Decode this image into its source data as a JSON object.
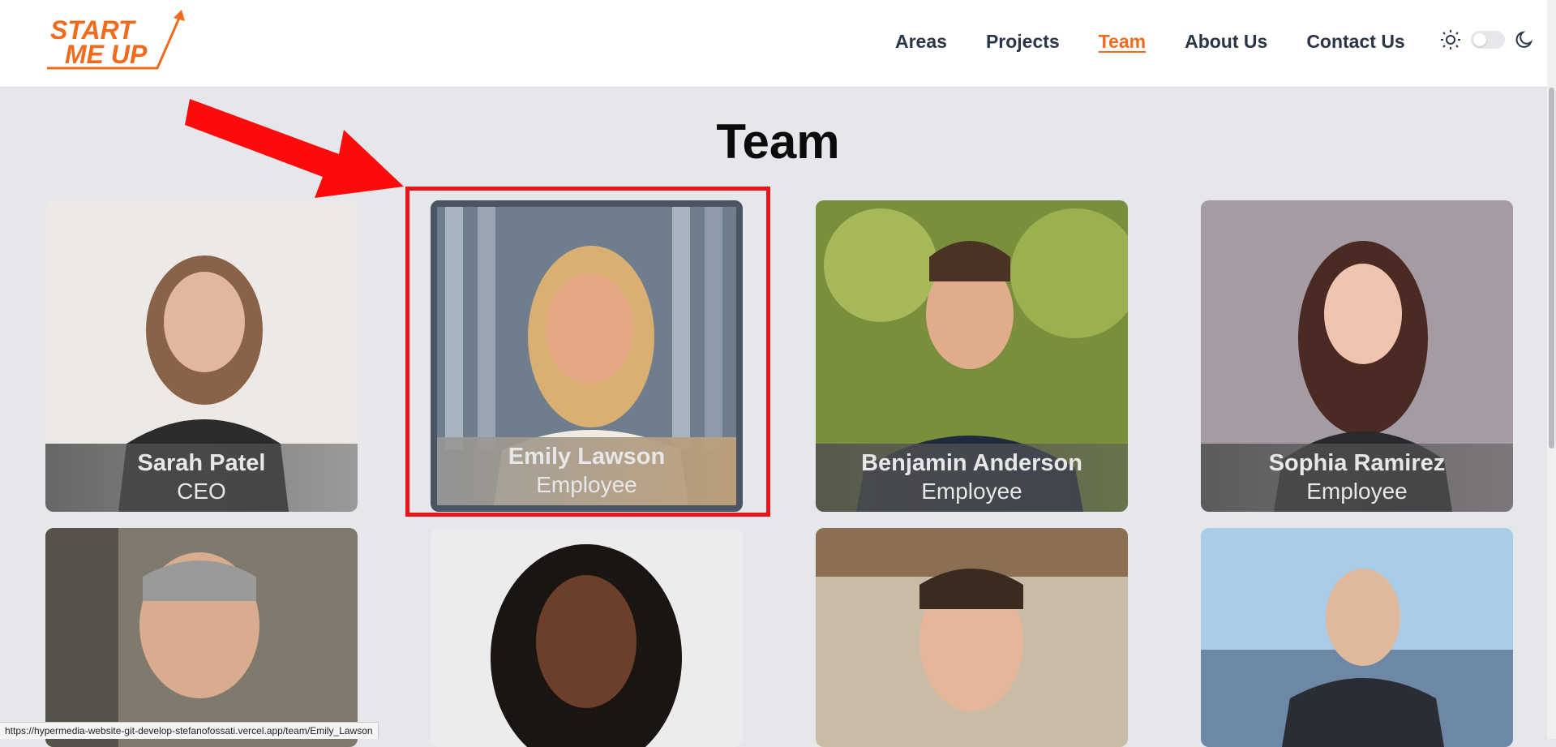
{
  "header": {
    "logo_line1": "START",
    "logo_line2": "ME UP",
    "nav": [
      {
        "label": "Areas"
      },
      {
        "label": "Projects"
      },
      {
        "label": "Team"
      },
      {
        "label": "About Us"
      },
      {
        "label": "Contact Us"
      }
    ],
    "active_nav": "Team",
    "theme_icons": [
      "sun-icon",
      "toggle",
      "moon-icon"
    ]
  },
  "page": {
    "title": "Team"
  },
  "team": [
    {
      "name": "Sarah Patel",
      "role": "CEO"
    },
    {
      "name": "Emily Lawson",
      "role": "Employee"
    },
    {
      "name": "Benjamin Anderson",
      "role": "Employee"
    },
    {
      "name": "Sophia Ramirez",
      "role": "Employee"
    }
  ],
  "status_url": "https://hypermedia-website-git-develop-stefanofossati.vercel.app/team/Emily_Lawson",
  "colors": {
    "accent": "#f26b1d",
    "highlight": "#e8141a",
    "background": "#e6e7eb"
  }
}
